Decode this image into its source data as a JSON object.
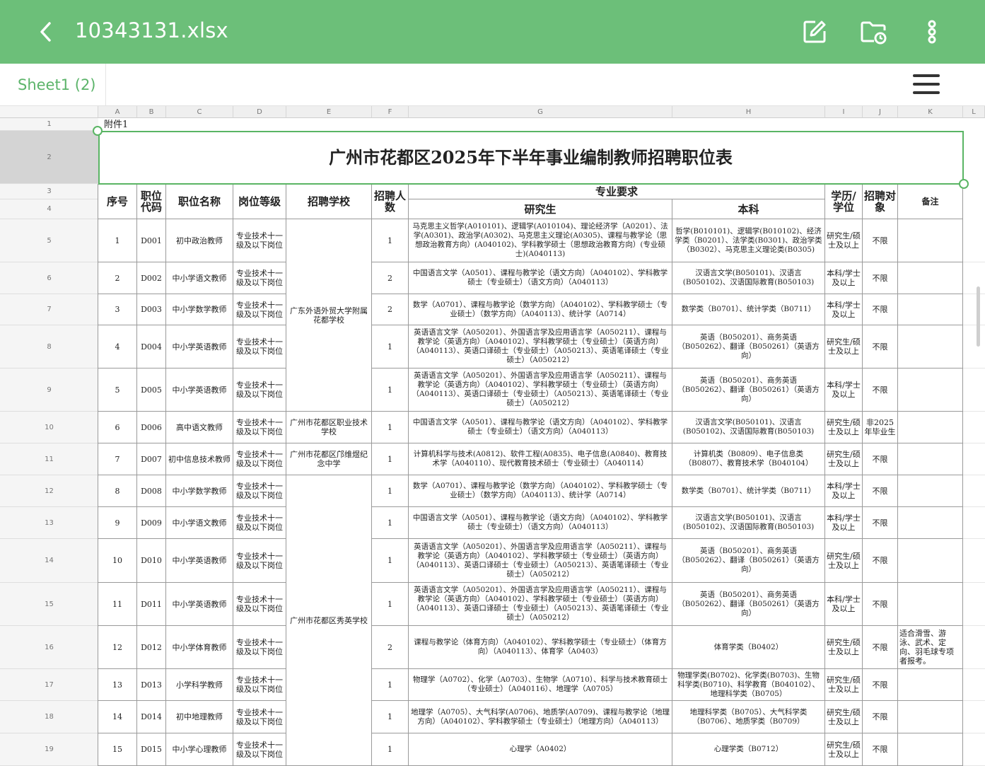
{
  "header": {
    "file_name": "10343131.xlsx",
    "back_icon": "chevron-left-icon",
    "edit_icon": "edit-icon",
    "folder_icon": "folder-clock-icon",
    "more_icon": "more-vertical-icon"
  },
  "sheet_tab": {
    "label": "Sheet1 (2)"
  },
  "columns": [
    "A",
    "B",
    "C",
    "D",
    "E",
    "F",
    "G",
    "H",
    "I",
    "J",
    "K",
    "L"
  ],
  "row_numbers": [
    "1",
    "2",
    "3",
    "4",
    "5",
    "6",
    "7",
    "8",
    "9",
    "10",
    "11",
    "12",
    "13",
    "14",
    "15",
    "16",
    "17",
    "18",
    "19"
  ],
  "sheet": {
    "a1": "附件1",
    "title": "广州市花都区2025年下半年事业编制教师招聘职位表",
    "headers": {
      "seq": "序号",
      "code": "职位代码",
      "name": "职位名称",
      "level": "岗位等级",
      "school": "招聘学校",
      "count": "招聘人数",
      "major": "专业要求",
      "grad": "研究生",
      "undergrad": "本科",
      "degree": "学历/学位",
      "target": "招聘对象",
      "note": "备注"
    },
    "schools": [
      "广东外语外贸大学附属花都学校",
      "广州市花都区职业技术学校",
      "广州市花都区邝维煜纪念中学",
      "广州市花都区秀英学校"
    ],
    "rows": [
      {
        "seq": "1",
        "code": "D001",
        "name": "初中政治教师",
        "level": "专业技术十一级及以下岗位",
        "count": "1",
        "grad": "马克思主义哲学(A010101)、逻辑学(A010104)、理论经济学（A0201）、法学(A0301)、政治学(A0302)、马克思主义理论(A0305)、课程与教学论（思想政治教育方向）(A040102)、学科教学硕士（思想政治教育方向）(专业硕士)(A040113)",
        "undergrad": "哲学(B010101)、逻辑学(B010102)、经济学类（B0201）、法学类(B0301)、政治学类（B0302）、马克思主义理论类(B0305)",
        "degree": "研究生/硕士及以上",
        "target": "不限",
        "note": ""
      },
      {
        "seq": "2",
        "code": "D002",
        "name": "中小学语文教师",
        "level": "专业技术十一级及以下岗位",
        "count": "2",
        "grad": "中国语言文学（A0501）、课程与教学论（语文方向）（A040102）、学科教学硕士（专业硕士）（语文方向）（A040113）",
        "undergrad": "汉语言文学(B050101)、汉语言(B050102)、汉语国际教育(B050103)",
        "degree": "本科/学士及以上",
        "target": "不限",
        "note": ""
      },
      {
        "seq": "3",
        "code": "D003",
        "name": "中小学数学教师",
        "level": "专业技术十一级及以下岗位",
        "count": "2",
        "grad": "数学（A0701）、课程与教学论（数学方向）（A040102）、学科教学硕士（专业硕士）（数学方向）（A040113）、统计学（A0714）",
        "undergrad": "数学类（B0701）、统计学类（B0711）",
        "degree": "本科/学士及以上",
        "target": "不限",
        "note": ""
      },
      {
        "seq": "4",
        "code": "D004",
        "name": "中小学英语教师",
        "level": "专业技术十一级及以下岗位",
        "count": "1",
        "grad": "英语语言文学（A050201）、外国语言学及应用语言学（A050211）、课程与教学论（英语方向）（A040102）、学科教学硕士（专业硕士）（英语方向）（A040113）、英语口译硕士（专业硕士）（A050213）、英语笔译硕士（专业硕士）（A050212）",
        "undergrad": "英语（B050201）、商务英语（B050262）、翻译（B050261）（英语方向）",
        "degree": "研究生/硕士及以上",
        "target": "不限",
        "note": ""
      },
      {
        "seq": "5",
        "code": "D005",
        "name": "中小学英语教师",
        "level": "专业技术十一级及以下岗位",
        "count": "1",
        "grad": "英语语言文学（A050201）、外国语言学及应用语言学（A050211）、课程与教学论（英语方向）（A040102）、学科教学硕士（专业硕士）（英语方向）（A040113）、英语口译硕士（专业硕士）（A050213）、英语笔译硕士（专业硕士）（A050212）",
        "undergrad": "英语（B050201）、商务英语（B050262）、翻译（B050261）（英语方向）",
        "degree": "本科/学士及以上",
        "target": "不限",
        "note": ""
      },
      {
        "seq": "6",
        "code": "D006",
        "name": "高中语文教师",
        "level": "专业技术十一级及以下岗位",
        "count": "1",
        "grad": "中国语言文学（A0501）、课程与教学论（语文方向）（A040102）、学科教学硕士（专业硕士）（语文方向）（A040113）",
        "undergrad": "汉语言文学(B050101)、汉语言(B050102)、汉语国际教育(B050103)",
        "degree": "研究生/硕士及以上",
        "target": "非2025年毕业生",
        "note": ""
      },
      {
        "seq": "7",
        "code": "D007",
        "name": "初中信息技术教师",
        "level": "专业技术十一级及以下岗位",
        "count": "1",
        "grad": "计算机科学与技术(A0812)、软件工程(A0835)、电子信息(A0840)、教育技术学（A040110）、现代教育技术硕士（专业硕士）（A040114）",
        "undergrad": "计算机类（B0809）、电子信息类（B0807）、教育技术学（B040104）",
        "degree": "研究生/硕士及以上",
        "target": "不限",
        "note": ""
      },
      {
        "seq": "8",
        "code": "D008",
        "name": "中小学数学教师",
        "level": "专业技术十一级及以下岗位",
        "count": "1",
        "grad": "数学（A0701）、课程与教学论（数学方向）（A040102）、学科教学硕士（专业硕士）（数学方向）（A040113）、统计学（A0714）",
        "undergrad": "数学类（B0701）、统计学类（B0711）",
        "degree": "本科/学士及以上",
        "target": "不限",
        "note": ""
      },
      {
        "seq": "9",
        "code": "D009",
        "name": "中小学语文教师",
        "level": "专业技术十一级及以下岗位",
        "count": "1",
        "grad": "中国语言文学（A0501）、课程与教学论（语文方向）（A040102）、学科教学硕士（专业硕士）（语文方向）（A040113）",
        "undergrad": "汉语言文学(B050101)、汉语言(B050102)、汉语国际教育(B050103)",
        "degree": "本科/学士及以上",
        "target": "不限",
        "note": ""
      },
      {
        "seq": "10",
        "code": "D010",
        "name": "中小学英语教师",
        "level": "专业技术十一级及以下岗位",
        "count": "1",
        "grad": "英语语言文学（A050201）、外国语言学及应用语言学（A050211）、课程与教学论（英语方向）（A040102）、学科教学硕士（专业硕士）（英语方向）（A040113）、英语口译硕士（专业硕士）（A050213）、英语笔译硕士（专业硕士）（A050212）",
        "undergrad": "英语（B050201）、商务英语（B050262）、翻译（B050261）（英语方向）",
        "degree": "研究生/硕士及以上",
        "target": "不限",
        "note": ""
      },
      {
        "seq": "11",
        "code": "D011",
        "name": "中小学英语教师",
        "level": "专业技术十一级及以下岗位",
        "count": "1",
        "grad": "英语语言文学（A050201）、外国语言学及应用语言学（A050211）、课程与教学论（英语方向）（A040102）、学科教学硕士（专业硕士）（英语方向）（A040113）、英语口译硕士（专业硕士）（A050213）、英语笔译硕士（专业硕士）（A050212）",
        "undergrad": "英语（B050201）、商务英语（B050262）、翻译（B050261）（英语方向）",
        "degree": "本科/学士及以上",
        "target": "不限",
        "note": ""
      },
      {
        "seq": "12",
        "code": "D012",
        "name": "中小学体育教师",
        "level": "专业技术十一级及以下岗位",
        "count": "2",
        "grad": "课程与教学论（体育方向）（A040102）、学科教学硕士（专业硕士）（体育方向）（A040113）、体育学（A0403）",
        "undergrad": "体育学类（B0402）",
        "degree": "研究生/硕士及以上",
        "target": "不限",
        "note": "适合滑雪、游泳、武术、定向、羽毛球专项者报考。"
      },
      {
        "seq": "13",
        "code": "D013",
        "name": "小学科学教师",
        "level": "专业技术十一级及以下岗位",
        "count": "1",
        "grad": "物理学（A0702）、化学（A0703）、生物学（A0710）、科学与技术教育硕士（专业硕士）（A040116）、地理学（A0705）",
        "undergrad": "物理学类(B0702)、化学类(B0703)、生物科学类(B0710)、科学教育（B040102）、地理科学类（B0705）",
        "degree": "研究生/硕士及以上",
        "target": "不限",
        "note": ""
      },
      {
        "seq": "14",
        "code": "D014",
        "name": "初中地理教师",
        "level": "专业技术十一级及以下岗位",
        "count": "1",
        "grad": "地理学（A0705）、大气科学(A0706)、地质学(A0709)、课程与教学论（地理方向）（A040102）、学科教学硕士（专业硕士）（地理方向）（A040113）",
        "undergrad": "地理科学类（B0705）、大气科学类（B0706）、地质学类（B0709）",
        "degree": "研究生/硕士及以上",
        "target": "不限",
        "note": ""
      },
      {
        "seq": "15",
        "code": "D015",
        "name": "中小学心理教师",
        "level": "专业技术十一级及以下岗位",
        "count": "1",
        "grad": "心理学（A0402）",
        "undergrad": "心理学类（B0712）",
        "degree": "研究生/硕士及以上",
        "target": "不限",
        "note": ""
      }
    ]
  }
}
